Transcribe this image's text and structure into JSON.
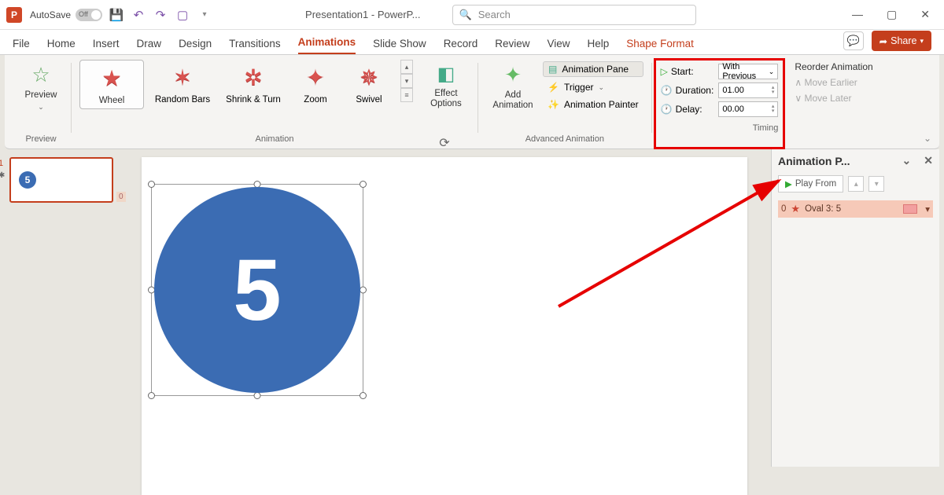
{
  "titlebar": {
    "autosave_label": "AutoSave",
    "autosave_state": "Off",
    "doc_title": "Presentation1 - PowerP...",
    "search_placeholder": "Search"
  },
  "tabs": {
    "items": [
      "File",
      "Home",
      "Insert",
      "Draw",
      "Design",
      "Transitions",
      "Animations",
      "Slide Show",
      "Record",
      "Review",
      "View",
      "Help"
    ],
    "context": "Shape Format",
    "active": "Animations",
    "share": "Share"
  },
  "ribbon": {
    "preview": {
      "label": "Preview",
      "group": "Preview"
    },
    "animation": {
      "items": [
        "Wheel",
        "Random Bars",
        "Shrink & Turn",
        "Zoom",
        "Swivel"
      ],
      "selected": 0,
      "group": "Animation",
      "effect_options": "Effect\nOptions"
    },
    "advanced": {
      "add": "Add\nAnimation",
      "pane": "Animation Pane",
      "trigger": "Trigger",
      "painter": "Animation Painter",
      "group": "Advanced Animation"
    },
    "timing": {
      "start_label": "Start:",
      "start_value": "With Previous",
      "duration_label": "Duration:",
      "duration_value": "01.00",
      "delay_label": "Delay:",
      "delay_value": "00.00",
      "group": "Timing"
    },
    "reorder": {
      "title": "Reorder Animation",
      "earlier": "Move Earlier",
      "later": "Move Later"
    }
  },
  "thumbs": {
    "slide1_num": "1",
    "circle_text": "5"
  },
  "canvas": {
    "ruler0": "0",
    "circle_text": "5"
  },
  "anipanel": {
    "title": "Animation P...",
    "play": "Play From",
    "item_num": "0",
    "item_name": "Oval 3: 5"
  }
}
